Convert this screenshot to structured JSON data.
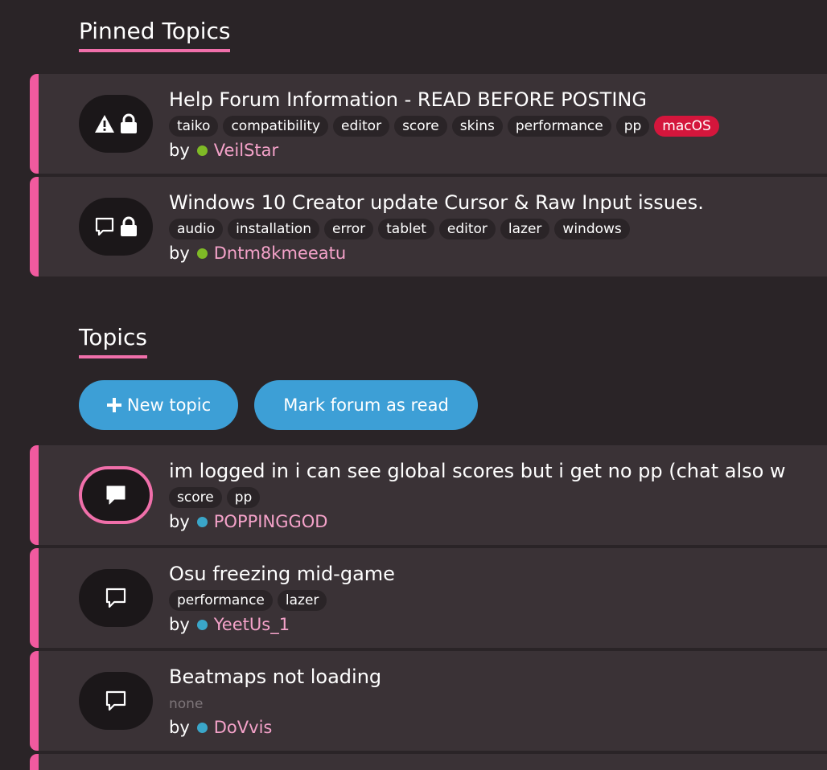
{
  "pinned": {
    "heading": "Pinned Topics",
    "topics": [
      {
        "title": "Help Forum Information - READ BEFORE POSTING",
        "tags": [
          "taiko",
          "compatibility",
          "editor",
          "score",
          "skins",
          "performance",
          "pp",
          "macOS"
        ],
        "highlight_tag": "macOS",
        "by": "by",
        "author": "VeilStar",
        "status_color": "#7fba26",
        "icons": [
          "warning-icon",
          "lock-icon"
        ]
      },
      {
        "title": "Windows 10 Creator update Cursor & Raw Input issues.",
        "tags": [
          "audio",
          "installation",
          "error",
          "tablet",
          "editor",
          "lazer",
          "windows"
        ],
        "by": "by",
        "author": "Dntm8kmeeatu",
        "status_color": "#7fba26",
        "icons": [
          "chat-outline-icon",
          "lock-icon"
        ]
      }
    ]
  },
  "topics": {
    "heading": "Topics",
    "new_topic_label": "New topic",
    "mark_read_label": "Mark forum as read",
    "items": [
      {
        "title": "im logged in i can see global scores but i get no pp (chat also w",
        "tags": [
          "score",
          "pp"
        ],
        "by": "by",
        "author": "POPPINGGOD",
        "status_color": "#3aa6c9",
        "icon": "chat-filled-icon",
        "unread": true
      },
      {
        "title": "Osu freezing mid-game",
        "tags": [
          "performance",
          "lazer"
        ],
        "by": "by",
        "author": "YeetUs_1",
        "status_color": "#3aa6c9",
        "icon": "chat-outline-icon",
        "unread": false
      },
      {
        "title": "Beatmaps not loading",
        "tags": [],
        "no_tags_label": "none",
        "by": "by",
        "author": "DoVvis",
        "status_color": "#3aa6c9",
        "icon": "chat-outline-icon",
        "unread": false
      }
    ]
  },
  "colors": {
    "accent_pink": "#f15a9f",
    "button_blue": "#3d9fd6",
    "macos_red": "#d4163c",
    "author_pink": "#f4a2c9"
  }
}
